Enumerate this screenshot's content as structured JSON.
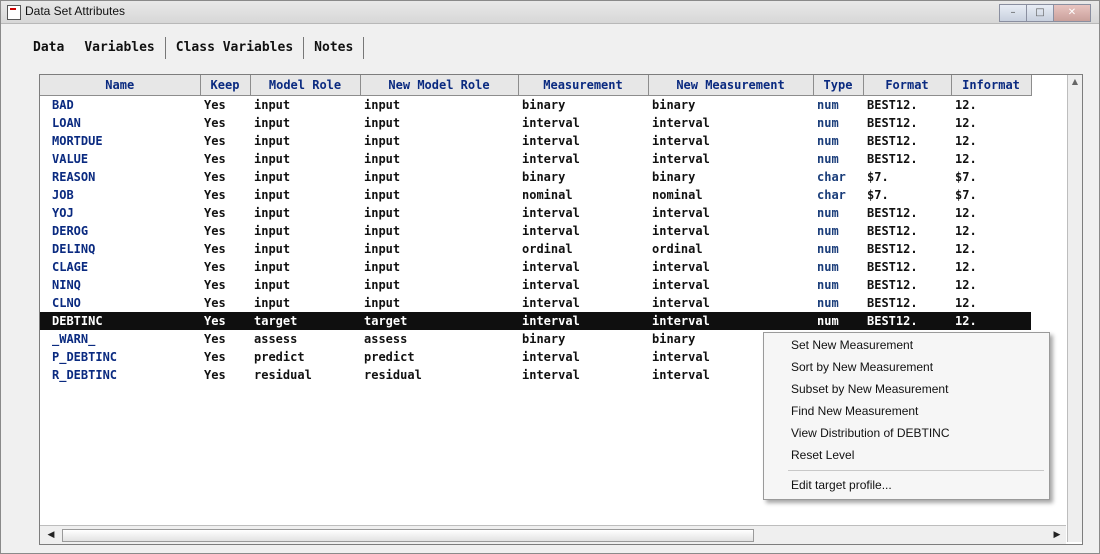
{
  "window": {
    "title": "Data Set Attributes",
    "controls": {
      "minimize": "–",
      "maximize": "□",
      "close": "✕"
    }
  },
  "tabs": [
    "Data",
    "Variables",
    "Class Variables",
    "Notes"
  ],
  "columns": [
    "Name",
    "Keep",
    "Model Role",
    "New Model Role",
    "Measurement",
    "New Measurement",
    "Type",
    "Format",
    "Informat"
  ],
  "rows": [
    [
      "BAD",
      "Yes",
      "input",
      "input",
      "binary",
      "binary",
      "num",
      "BEST12.",
      "12."
    ],
    [
      "LOAN",
      "Yes",
      "input",
      "input",
      "interval",
      "interval",
      "num",
      "BEST12.",
      "12."
    ],
    [
      "MORTDUE",
      "Yes",
      "input",
      "input",
      "interval",
      "interval",
      "num",
      "BEST12.",
      "12."
    ],
    [
      "VALUE",
      "Yes",
      "input",
      "input",
      "interval",
      "interval",
      "num",
      "BEST12.",
      "12."
    ],
    [
      "REASON",
      "Yes",
      "input",
      "input",
      "binary",
      "binary",
      "char",
      "$7.",
      "$7."
    ],
    [
      "JOB",
      "Yes",
      "input",
      "input",
      "nominal",
      "nominal",
      "char",
      "$7.",
      "$7."
    ],
    [
      "YOJ",
      "Yes",
      "input",
      "input",
      "interval",
      "interval",
      "num",
      "BEST12.",
      "12."
    ],
    [
      "DEROG",
      "Yes",
      "input",
      "input",
      "interval",
      "interval",
      "num",
      "BEST12.",
      "12."
    ],
    [
      "DELINQ",
      "Yes",
      "input",
      "input",
      "ordinal",
      "ordinal",
      "num",
      "BEST12.",
      "12."
    ],
    [
      "CLAGE",
      "Yes",
      "input",
      "input",
      "interval",
      "interval",
      "num",
      "BEST12.",
      "12."
    ],
    [
      "NINQ",
      "Yes",
      "input",
      "input",
      "interval",
      "interval",
      "num",
      "BEST12.",
      "12."
    ],
    [
      "CLNO",
      "Yes",
      "input",
      "input",
      "interval",
      "interval",
      "num",
      "BEST12.",
      "12."
    ],
    [
      "DEBTINC",
      "Yes",
      "target",
      "target",
      "interval",
      "interval",
      "num",
      "BEST12.",
      "12."
    ],
    [
      "_WARN_",
      "Yes",
      "assess",
      "assess",
      "binary",
      "binary",
      "",
      "",
      ""
    ],
    [
      "P_DEBTINC",
      "Yes",
      "predict",
      "predict",
      "interval",
      "interval",
      "",
      "",
      ""
    ],
    [
      "R_DEBTINC",
      "Yes",
      "residual",
      "residual",
      "interval",
      "interval",
      "",
      "",
      ""
    ]
  ],
  "selected_row": "DEBTINC",
  "context_menu": {
    "items": [
      "Set New Measurement",
      "Sort by New Measurement",
      "Subset by New Measurement",
      "Find New Measurement",
      "View Distribution of DEBTINC",
      "Reset Level",
      "Edit target profile..."
    ]
  },
  "scrollbars": {
    "left_arrow": "◀",
    "right_arrow": "▶",
    "up_arrow": "▲"
  },
  "colors": {
    "header_text": "#0a2a80",
    "selected_bg": "#0f0f0f",
    "selected_text": "#ffffff"
  }
}
